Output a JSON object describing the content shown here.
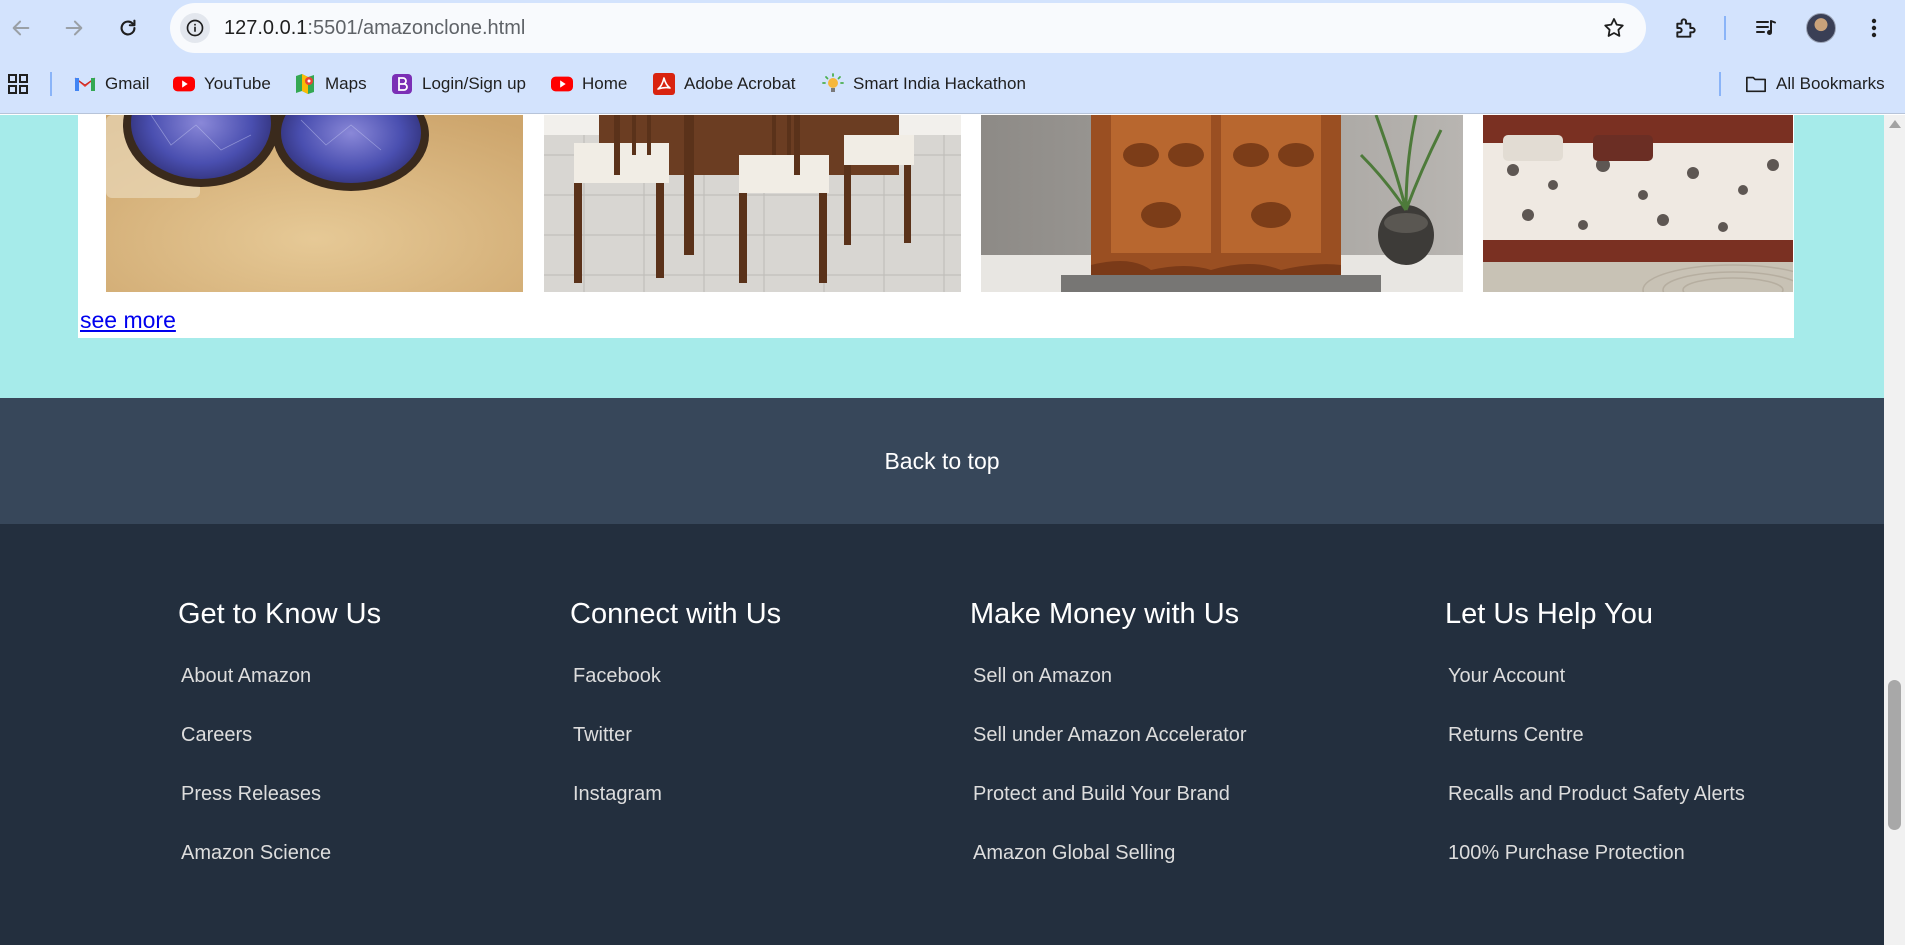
{
  "browser": {
    "url_host": "127.0.0.1",
    "url_rest": ":5501/amazonclone.html"
  },
  "bookmarks": {
    "items": [
      {
        "label": "Gmail",
        "icon": "gmail-icon"
      },
      {
        "label": "YouTube",
        "icon": "youtube-icon"
      },
      {
        "label": "Maps",
        "icon": "maps-icon"
      },
      {
        "label": "Login/Sign up",
        "icon": "login-icon"
      },
      {
        "label": "Home",
        "icon": "youtube-icon"
      },
      {
        "label": "Adobe Acrobat",
        "icon": "acrobat-icon"
      },
      {
        "label": "Smart India Hackathon",
        "icon": "hackathon-icon"
      }
    ],
    "all_bookmarks": "All Bookmarks"
  },
  "page": {
    "see_more": "see more",
    "back_to_top": "Back to top"
  },
  "footer": {
    "columns": [
      {
        "title": "Get to Know Us",
        "links": [
          "About Amazon",
          "Careers",
          "Press Releases",
          "Amazon Science"
        ]
      },
      {
        "title": "Connect with Us",
        "links": [
          "Facebook",
          "Twitter",
          "Instagram"
        ]
      },
      {
        "title": "Make Money with Us",
        "links": [
          "Sell on Amazon",
          "Sell under Amazon Accelerator",
          "Protect and Build Your Brand",
          "Amazon Global Selling"
        ]
      },
      {
        "title": "Let Us Help You",
        "links": [
          "Your Account",
          "Returns Centre",
          "Recalls and Product Safety Alerts",
          "100% Purchase Protection"
        ]
      }
    ]
  },
  "colors": {
    "teal_section": "#a6ebea",
    "back_to_top_bg": "#37475a",
    "footer_bg": "#232f3e",
    "link_blue": "#0000ee"
  }
}
